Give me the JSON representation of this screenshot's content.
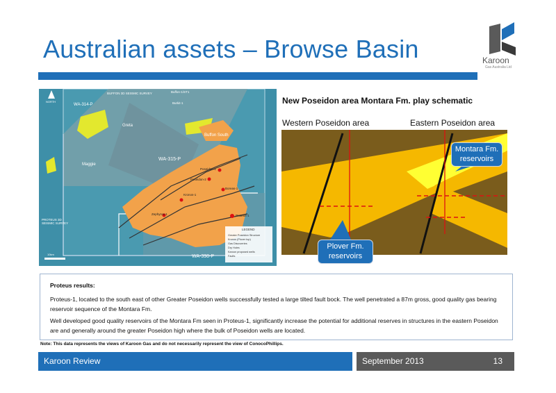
{
  "slide": {
    "title": "Australian assets – Browse Basin"
  },
  "logo": {
    "name": "Karoon",
    "subtitle": "Gas Australia Ltd"
  },
  "map": {
    "labels": {
      "wa314": "WA-314-P",
      "wa315": "WA-315-P",
      "wa398": "WA-398-P",
      "greta": "Greta",
      "buffon_south": "Buffon South",
      "maggie": "Maggie",
      "buffon_survey": "BUFFON 3D SEISMIC SURVEY",
      "proteus_survey": "PROTEUS 3D SEISMIC SURVEY",
      "north": "NORTH",
      "scale": "10km",
      "legend_title": "LEGEND",
      "legend_items": [
        "Greater Poseidon Structure",
        "Kronos (Plover top)",
        "Gas Discoveries",
        "Dry Holes",
        "Karoon proposed wells",
        "Faults"
      ],
      "wells": [
        "Buffon-1/ST1",
        "Burkit-1",
        "Poseidon-1",
        "Poseidon-2",
        "Kronos-1",
        "Boreas-1",
        "Proteus-1",
        "Zephyros-1"
      ]
    }
  },
  "schematic": {
    "title": "New Poseidon area Montara Fm. play schematic",
    "western": "Western Poseidon area",
    "eastern": "Eastern Poseidon area",
    "montara_callout": [
      "Montara Fm.",
      "reservoirs"
    ],
    "plover_callout": [
      "Plover Fm.",
      "reservoirs"
    ],
    "colors": {
      "background": "#7a5c1c",
      "layer": "#f5b800",
      "montara": "#ffff33",
      "pointer": "#d11"
    }
  },
  "results": {
    "heading": "Proteus results:",
    "p1": "Proteus-1, located to the south east of other Greater Poseidon wells successfully tested a large tilted fault bock. The well penetrated a 87m gross, good quality gas bearing reservoir sequence of the Montara Fm.",
    "p2": "Well developed good quality reservoirs of the Montara Fm seen in Proteus-1, significantly increase the potential for additional reserves in structures in the eastern Poseidon are and generally around the greater Poseidon high where the bulk of Poseidon wells are located."
  },
  "note": "Note: This data represents the views of Karoon Gas and do not necessarily represent the view of ConocoPhillips.",
  "footer": {
    "left": "Karoon Review",
    "date": "September 2013",
    "page": "13"
  }
}
